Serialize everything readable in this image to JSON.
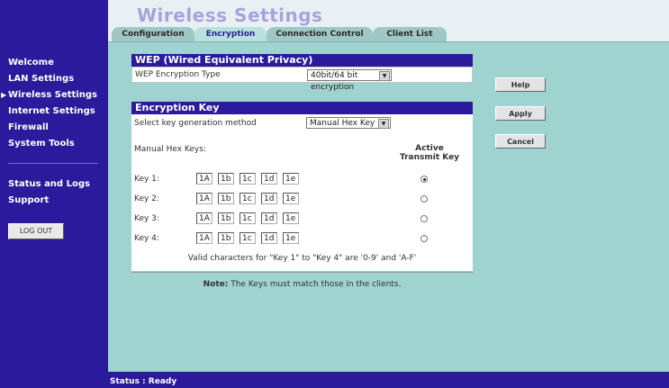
{
  "page": {
    "title": "Wireless Settings"
  },
  "tabs": [
    {
      "label": "Configuration",
      "active": false
    },
    {
      "label": "Encryption",
      "active": true
    },
    {
      "label": "Connection Control",
      "active": false
    },
    {
      "label": "Client List",
      "active": false
    }
  ],
  "nav": {
    "items": [
      {
        "label": "Welcome"
      },
      {
        "label": "LAN Settings"
      },
      {
        "label": "Wireless Settings",
        "current": true
      },
      {
        "label": "Internet Settings"
      },
      {
        "label": "Firewall"
      },
      {
        "label": "System Tools"
      },
      {
        "label": "Status and Logs"
      },
      {
        "label": "Support"
      }
    ],
    "logout_label": "LOG OUT",
    "current_marker": "▶"
  },
  "wep": {
    "heading": "WEP (Wired Equivalent Privacy)",
    "type_label": "WEP Encryption Type",
    "type_value": "40bit/64 bit encryption"
  },
  "enc_key": {
    "heading": "Encryption Key",
    "method_label": "Select key generation method",
    "method_value": "Manual Hex Key",
    "manual_hex_label": "Manual Hex Keys:",
    "active_header_line1": "Active",
    "active_header_line2": "Transmit Key",
    "keys": [
      {
        "label": "Key 1:",
        "values": [
          "1A",
          "1b",
          "1c",
          "1d",
          "1e"
        ],
        "active": true
      },
      {
        "label": "Key 2:",
        "values": [
          "1A",
          "1b",
          "1c",
          "1d",
          "1e"
        ],
        "active": false
      },
      {
        "label": "Key 3:",
        "values": [
          "1A",
          "1b",
          "1c",
          "1d",
          "1e"
        ],
        "active": false
      },
      {
        "label": "Key 4:",
        "values": [
          "1A",
          "1b",
          "1c",
          "1d",
          "1e"
        ],
        "active": false
      }
    ],
    "valid_chars_text": "Valid characters for \"Key 1\" to \"Key 4\" are '0-9' and 'A-F'"
  },
  "note": {
    "bold": "Note:",
    "text": "The Keys must match those in the clients."
  },
  "buttons": {
    "help": "Help",
    "apply": "Apply",
    "cancel": "Cancel"
  },
  "status": {
    "text": "Status : Ready"
  },
  "colors": {
    "nav_bg": "#2b1a9c",
    "page_bg": "#9fd3cf",
    "header_bg": "#e8f0f4",
    "title_color": "#a8a3d9"
  }
}
